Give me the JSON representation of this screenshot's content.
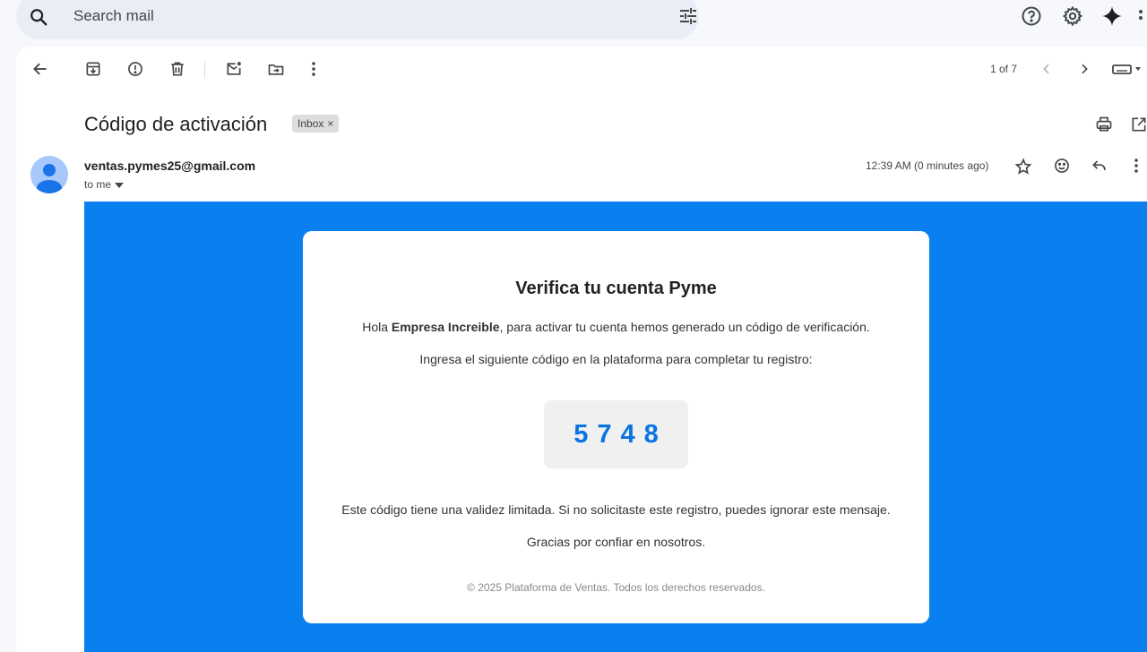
{
  "search": {
    "placeholder": "Search mail"
  },
  "toolbar": {
    "pager": "1 of 7"
  },
  "message": {
    "subject": "Código de activación",
    "label": "Inbox",
    "label_remove": "×",
    "sender": "ventas.pymes25@gmail.com",
    "recipient": "to me",
    "time": "12:39 AM (0 minutes ago)"
  },
  "email": {
    "title": "Verifica tu cuenta Pyme",
    "greeting_prefix": "Hola ",
    "company": "Empresa Increible",
    "greeting_suffix": ", para activar tu cuenta hemos generado un código de verificación.",
    "instruction": "Ingresa el siguiente código en la plataforma para completar tu registro:",
    "code": "5748",
    "validity": "Este código tiene una validez limitada. Si no solicitaste este registro, puedes ignorar este mensaje.",
    "thanks": "Gracias por confiar en nosotros.",
    "footer": "© 2025 Plataforma de Ventas. Todos los derechos reservados."
  },
  "colors": {
    "email_background": "#0a80f0",
    "code_color": "#0a74e0",
    "avatar": "#a8c7fa"
  }
}
